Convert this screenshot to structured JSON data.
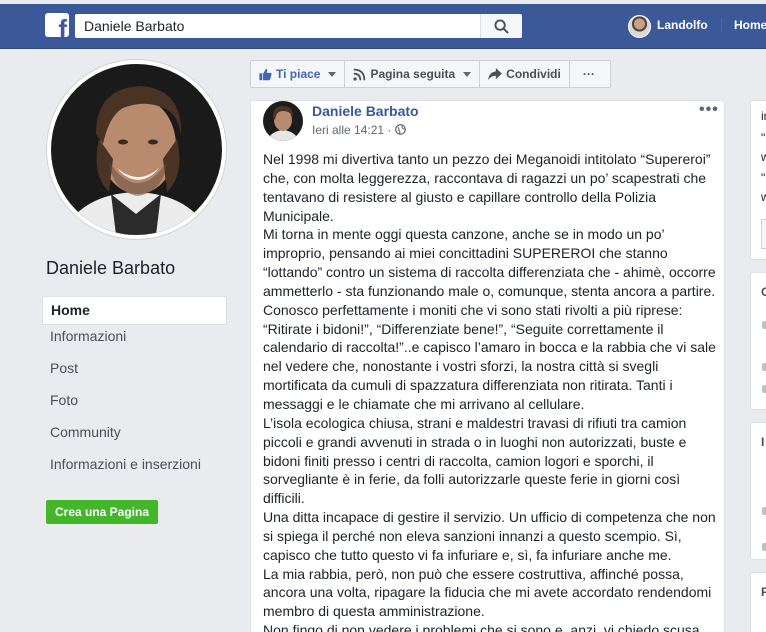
{
  "topbar": {
    "logo": "facebook-f-logo",
    "search_value": "Daniele Barbato",
    "search_icon": "search-icon",
    "user_name": "Landolfo",
    "home_label": "Home"
  },
  "page": {
    "title": "Daniele Barbato",
    "nav": [
      {
        "label": "Home"
      },
      {
        "label": "Informazioni"
      },
      {
        "label": "Post"
      },
      {
        "label": "Foto"
      },
      {
        "label": "Community"
      },
      {
        "label": "Informazioni e inserzioni"
      }
    ],
    "create_page_label": "Crea una Pagina"
  },
  "actions": {
    "like": "Ti piace",
    "follow": "Pagina seguita",
    "share": "Condividi",
    "more": "···"
  },
  "post": {
    "author": "Daniele Barbato",
    "time": "Ieri alle 14:21 · ",
    "more": "•••",
    "paragraphs": [
      "Nel 1998 mi divertiva tanto un pezzo dei Meganoidi intitolato “Supereroi” che, con molta leggerezza, raccontava di ragazzi un po’ scapestrati che tentavano di resistere al giusto e capillare controllo della Polizia Municipale.",
      "Mi torna in mente oggi questa canzone, anche se in modo un po’ improprio, pensando ai miei concittadini SUPEREROI che stanno “lottando” contro un sistema di raccolta differenziata che - ahimè, occorre ammetterlo - sta funzionando male o, comunque, stenta ancora a partire. Conosco perfettamente i moniti che vi sono stati rivolti a più riprese: “Ritirate i bidoni!”, “Differenziate bene!”, “Seguite correttamente il calendario di raccolta!”..e capisco l’amaro in bocca e la rabbia che vi sale nel vedere che, nonostante i vostri sforzi, la nostra città si svegli mortificata da cumuli di spazzatura differenziata non ritirata. Tanti i messaggi e le chiamate che mi arrivano al cellulare.",
      "L’isola ecologica chiusa, strani e maldestri travasi di rifiuti tra camion piccoli e grandi avvenuti in strada o in luoghi non autorizzati, buste e bidoni finiti presso i centri di raccolta, camion logori e sporchi, il sorvegliante è in ferie, da folli autorizzarle queste ferie in giorni così difficili.",
      "Una ditta incapace di gestire il servizio. Un ufficio di competenza che non si spiega il perché non eleva sanzioni innanzi a questo scempio. Sì, capisco che tutto questo vi fa infuriare e, sì, fa infuriare anche me.",
      "La mia rabbia, però, non può che essere costruttiva, affinché possa, ancora una volta, ripagare la fiducia che mi avete accordato rendendomi membro di questa amministrazione.",
      "Non fingo di non vedere i problemi che si sono e, anzi, vi chiedo scusa"
    ]
  },
  "right_column": {
    "card1_lines": [
      "ir",
      "\"",
      "w",
      "\"",
      "w"
    ],
    "card2_letter": "C",
    "card3_letter": "I",
    "card4_letter": "P"
  }
}
